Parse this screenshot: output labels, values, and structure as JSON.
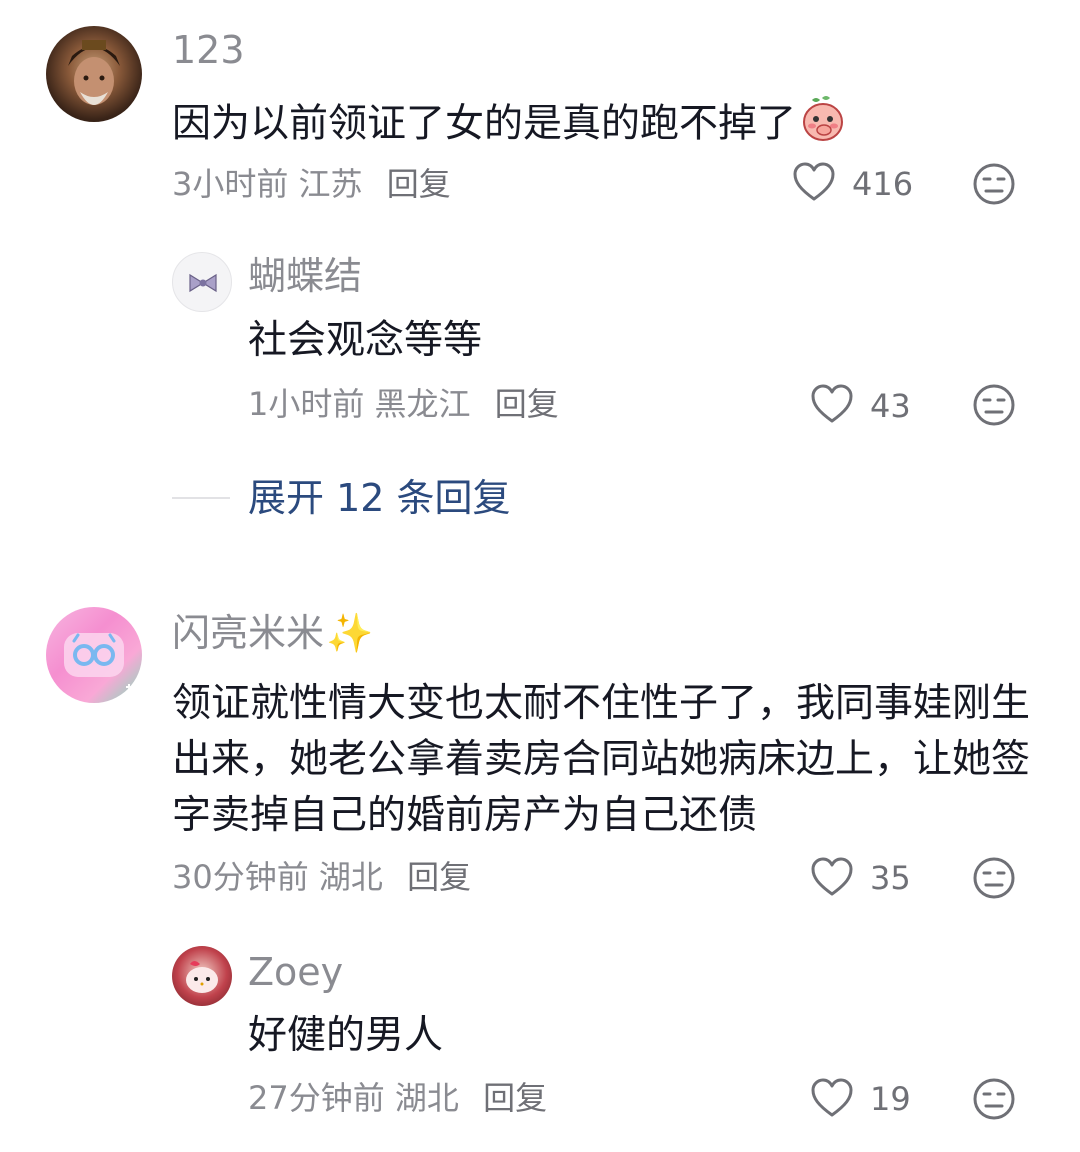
{
  "comments": [
    {
      "user": "123",
      "text": "因为以前领证了女的是真的跑不掉了",
      "time": "3小时前",
      "location": "江苏",
      "reply_label": "回复",
      "likes": "416",
      "emoji": "peach-face-covering-mouth"
    },
    {
      "user": "蝴蝶结",
      "text": "社会观念等等",
      "time": "1小时前",
      "location": "黑龙江",
      "reply_label": "回复",
      "likes": "43"
    },
    {
      "user": "闪亮米米",
      "user_emoji": "✨",
      "text": "领证就性情大变也太耐不住性子了，我同事娃刚生出来，她老公拿着卖房合同站她病床边上，让她签字卖掉自己的婚前房产为自己还债",
      "time": "30分钟前",
      "location": "湖北",
      "reply_label": "回复",
      "likes": "35"
    },
    {
      "user": "Zoey",
      "text": "好健的男人",
      "time": "27分钟前",
      "location": "湖北",
      "reply_label": "回复",
      "likes": "19"
    }
  ],
  "expand": {
    "label": "展开 12 条回复"
  },
  "colors": {
    "username": "#8a8b91",
    "text": "#161823",
    "expand_link": "#2b4a7e"
  }
}
